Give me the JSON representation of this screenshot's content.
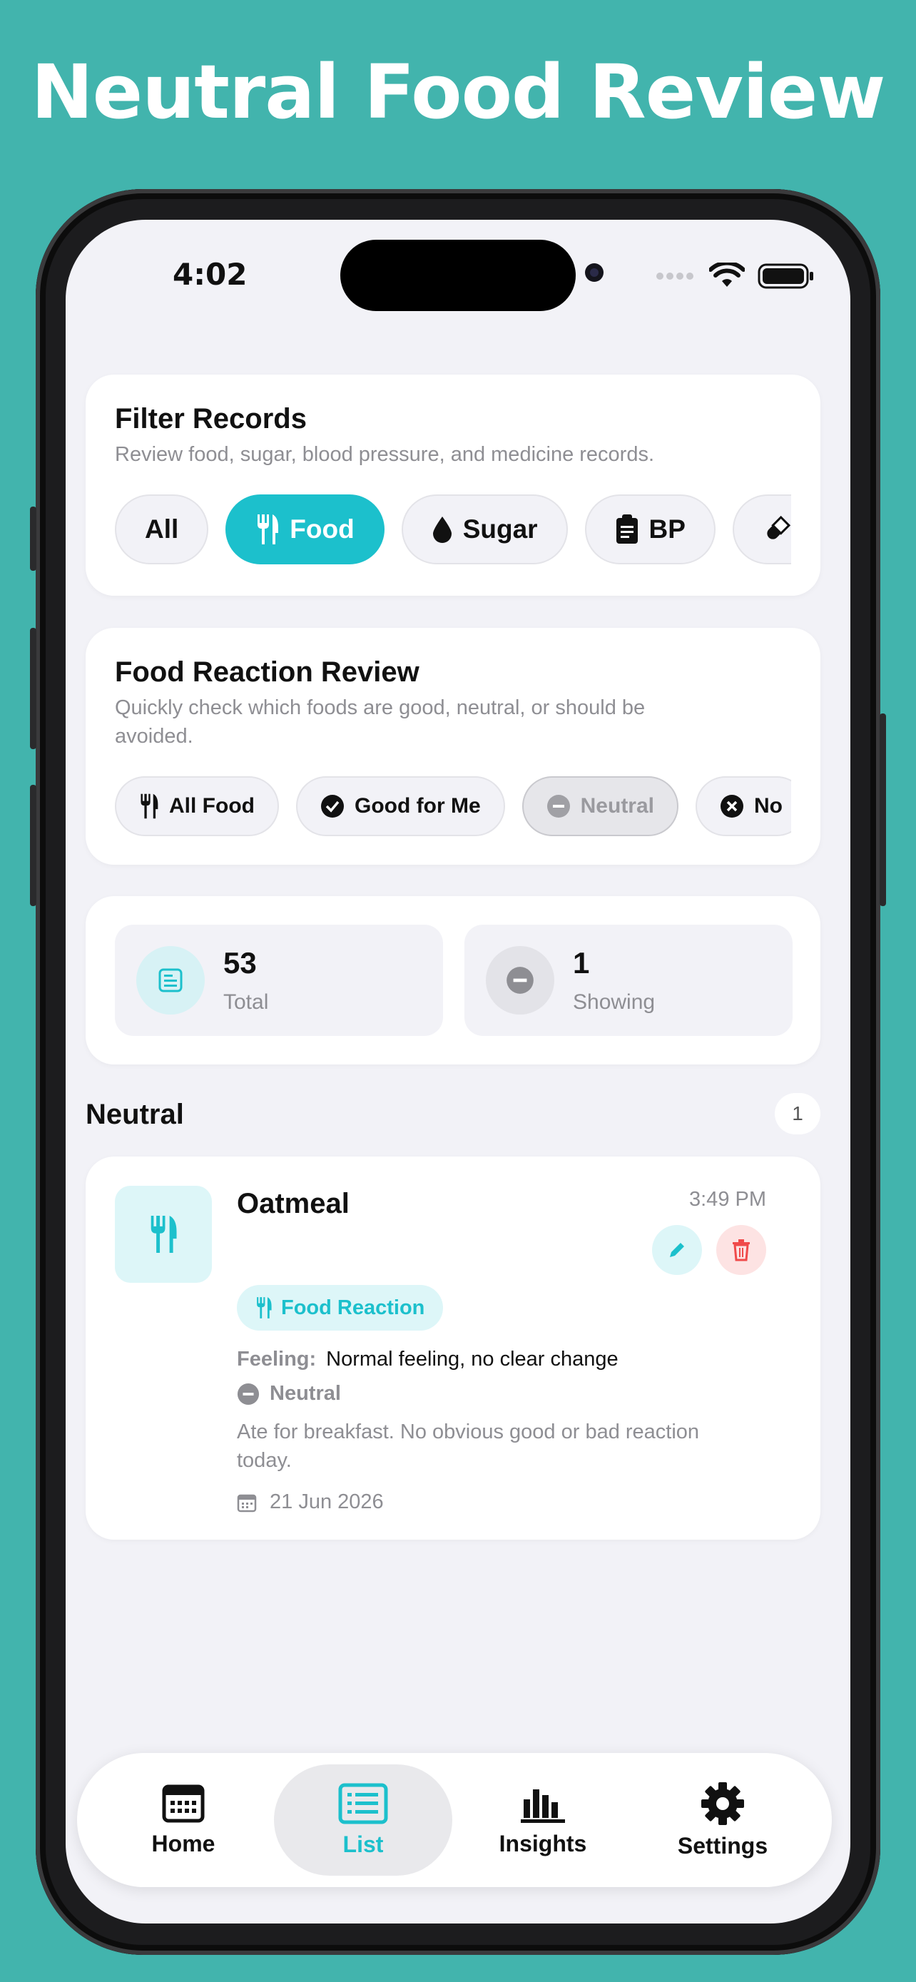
{
  "headline": "Neutral Food Review",
  "status": {
    "time": "4:02"
  },
  "filter": {
    "title": "Filter Records",
    "subtitle": "Review food, sugar, blood pressure, and medicine records.",
    "chips": [
      {
        "label": "All",
        "icon": "none",
        "active": false
      },
      {
        "label": "Food",
        "icon": "fork-knife-icon",
        "active": true
      },
      {
        "label": "Sugar",
        "icon": "drop-icon",
        "active": false
      },
      {
        "label": "BP",
        "icon": "clipboard-icon",
        "active": false
      },
      {
        "label": "",
        "icon": "pill-icon",
        "active": false
      }
    ]
  },
  "reaction": {
    "title": "Food Reaction Review",
    "subtitle": "Quickly check which foods are good, neutral, or should be avoided.",
    "chips": [
      {
        "label": "All Food",
        "icon": "fork-knife-icon"
      },
      {
        "label": "Good for Me",
        "icon": "check-circle-icon"
      },
      {
        "label": "Neutral",
        "icon": "minus-circle-icon",
        "selected": true
      },
      {
        "label": "No",
        "icon": "x-circle-icon"
      }
    ]
  },
  "stats": {
    "total_value": "53",
    "total_label": "Total",
    "showing_value": "1",
    "showing_label": "Showing"
  },
  "section": {
    "title": "Neutral",
    "count": "1"
  },
  "record": {
    "name": "Oatmeal",
    "time": "3:49 PM",
    "tag": "Food Reaction",
    "feeling_label": "Feeling:",
    "feeling_value": "Normal feeling, no clear change",
    "reaction": "Neutral",
    "note": "Ate for breakfast. No obvious good or bad reaction today.",
    "date": "21 Jun 2026"
  },
  "tabs": [
    {
      "label": "Home",
      "icon": "calendar-icon"
    },
    {
      "label": "List",
      "icon": "list-icon",
      "active": true
    },
    {
      "label": "Insights",
      "icon": "bar-chart-icon"
    },
    {
      "label": "Settings",
      "icon": "gear-icon"
    }
  ],
  "colors": {
    "background": "#42B4AD",
    "accent": "#1CC0CC",
    "danger": "#F04A4A",
    "screen": "#F2F2F7"
  }
}
